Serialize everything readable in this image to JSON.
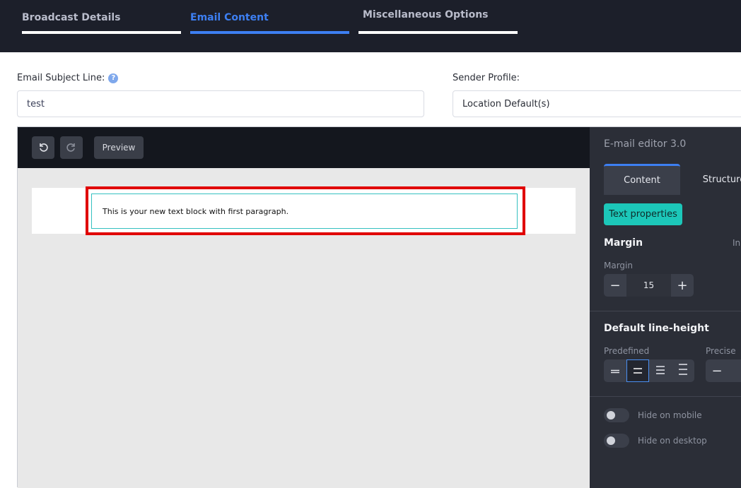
{
  "top_tabs": [
    {
      "label": "Broadcast Details",
      "active": false
    },
    {
      "label": "Email Content",
      "active": true
    },
    {
      "label": "Miscellaneous Options",
      "active": false
    }
  ],
  "subject": {
    "label": "Email Subject Line:",
    "help_icon": "?",
    "value": "test"
  },
  "sender": {
    "label": "Sender Profile:",
    "value": "Location Default(s)"
  },
  "toolbar": {
    "undo_icon": "undo-icon",
    "redo_icon": "redo-icon",
    "preview_label": "Preview"
  },
  "canvas": {
    "text_block": "This is your new text block with first paragraph."
  },
  "panel": {
    "title": "E-mail editor 3.0",
    "tabs": [
      {
        "label": "Content",
        "active": true
      },
      {
        "label": "Structure",
        "active": false
      }
    ],
    "text_properties_label": "Text properties",
    "margin": {
      "heading": "Margin",
      "right_label_partial": "In",
      "field_label": "Margin",
      "value": "15",
      "minus": "−",
      "plus": "+"
    },
    "line_height": {
      "heading": "Default line-height",
      "predefined_label": "Predefined",
      "precise_label": "Precise",
      "minus": "−",
      "selected_index": 1
    },
    "toggles": [
      {
        "label": "Hide on mobile",
        "on": false
      },
      {
        "label": "Hide on desktop",
        "on": false
      }
    ]
  },
  "colors": {
    "accent": "#3d7ff2",
    "teal": "#1cc7b9",
    "highlight": "#e00000",
    "topbar": "#1c1f2a",
    "panel": "#2b2e37"
  }
}
